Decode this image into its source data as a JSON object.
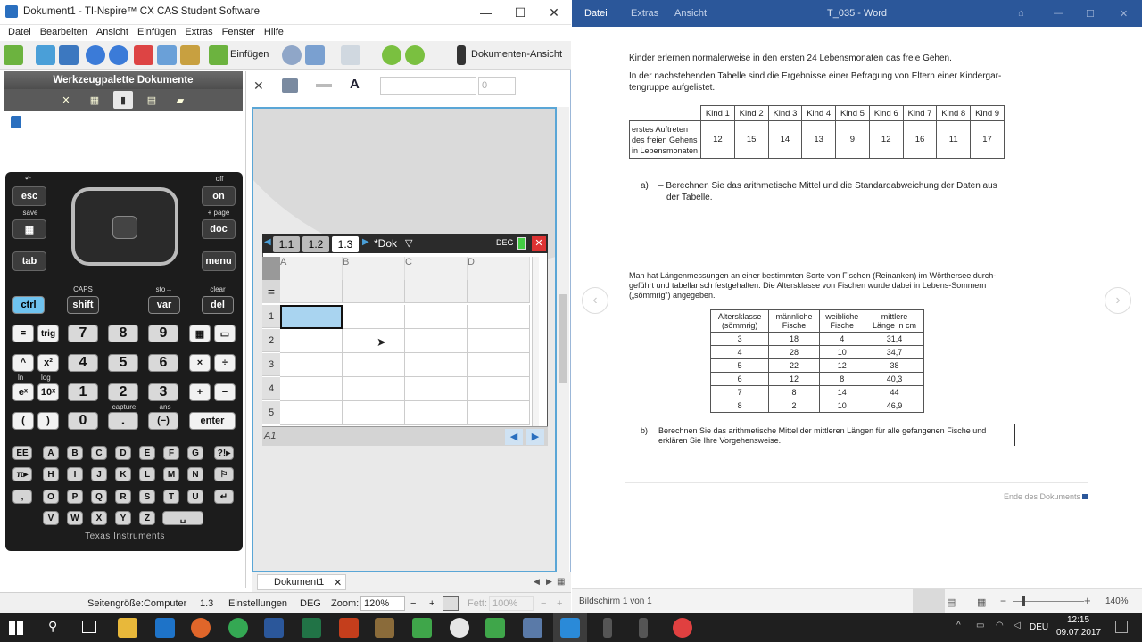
{
  "ti": {
    "title": "Dokument1 - TI-Nspire™ CX CAS Student Software",
    "window_controls": [
      "—",
      "☐",
      "✕"
    ],
    "menu": [
      "Datei",
      "Bearbeiten",
      "Ansicht",
      "Einfügen",
      "Extras",
      "Fenster",
      "Hilfe"
    ],
    "toolbar": {
      "insert_label": "Einfügen",
      "view_label": "Dokumenten-Ansicht",
      "font_size_value": "0"
    },
    "palette_title": "Werkzeugpalette Dokumente",
    "keys": {
      "esc": "esc",
      "on": "on",
      "save": "save",
      "off": "off",
      "page": "+ page",
      "doc": "doc",
      "tab": "tab",
      "menu": "menu",
      "caps": "CAPS",
      "sto": "sto→",
      "clear": "clear",
      "ctrl": "ctrl",
      "shift": "shift",
      "var": "var",
      "del": "del",
      "eq": "=",
      "trig": "trig",
      "n7": "7",
      "n8": "8",
      "n9": "9",
      "caret": "^",
      "x2": "x²",
      "n4": "4",
      "n5": "5",
      "n6": "6",
      "mul": "×",
      "div": "÷",
      "ex": "eˣ",
      "tenx": "10ˣ",
      "n1": "1",
      "n2": "2",
      "n3": "3",
      "plus": "+",
      "minus": "−",
      "lparen": "(",
      "rparen": ")",
      "n0": "0",
      "dot": ".",
      "neg": "(−)",
      "enter": "enter",
      "ln": "ln",
      "log": "log",
      "capture": "capture",
      "ans": "ans",
      "ee": "EE",
      "pi": "π▸",
      "comma": ",",
      "qm": "?!▸",
      "flag": "⚐",
      "letters1": [
        "A",
        "B",
        "C",
        "D",
        "E",
        "F",
        "G"
      ],
      "letters2": [
        "H",
        "I",
        "J",
        "K",
        "L",
        "M",
        "N"
      ],
      "letters3": [
        "O",
        "P",
        "Q",
        "R",
        "S",
        "T",
        "U"
      ],
      "letters4": [
        "V",
        "W",
        "X",
        "Y",
        "Z"
      ]
    },
    "brand": "Texas Instruments",
    "calc": {
      "tabs": [
        "1.1",
        "1.2",
        "1.3"
      ],
      "doc_label": "*Dok",
      "mode": "DEG",
      "columns": [
        "A",
        "B",
        "C",
        "D"
      ],
      "rows": [
        "1",
        "2",
        "3",
        "4",
        "5"
      ],
      "entry_label": "A1"
    },
    "doc_tab": "Dokument1",
    "status": {
      "page_size": "Seitengröße:Computer",
      "page": "1.3",
      "settings": "Einstellungen",
      "mode": "DEG",
      "zoom_label": "Zoom:",
      "zoom": "120%",
      "fett_label": "Fett:",
      "fett": "100%"
    }
  },
  "word": {
    "tabs": [
      "Datei",
      "Extras",
      "Ansicht"
    ],
    "title": "T_035 - Word",
    "intro1": "Kinder erlernen normalerweise in den ersten 24 Lebensmonaten das freie Gehen.",
    "intro2": "In der nachstehenden Tabelle sind die Ergebnisse einer Befragung von Eltern einer Kindergar-",
    "intro3": "tengruppe aufgelistet.",
    "table1": {
      "headers": [
        "",
        "Kind 1",
        "Kind 2",
        "Kind 3",
        "Kind 4",
        "Kind 5",
        "Kind 6",
        "Kind 7",
        "Kind 8",
        "Kind 9"
      ],
      "row_label": [
        "erstes Auftreten",
        "des freien Gehens",
        "in Lebensmonaten"
      ],
      "values": [
        "12",
        "15",
        "14",
        "13",
        "9",
        "12",
        "16",
        "11",
        "17"
      ]
    },
    "task_a_label": "a)",
    "task_a1": "– Berechnen Sie das arithmetische Mittel und die Standardabweichung der Daten aus",
    "task_a2": "der Tabelle.",
    "para2_1": "Man hat Längenmessungen an einer bestimmten Sorte von Fischen (Reinanken) im Wörthersee durch-",
    "para2_2": "geführt und tabellarisch festgehalten. Die Altersklasse von Fischen wurde dabei in Lebens-Sommern",
    "para2_3": "(„sömmrig“) angegeben.",
    "table2": {
      "headers": [
        [
          "Altersklasse",
          "(sömmrig)"
        ],
        [
          "männliche",
          "Fische"
        ],
        [
          "weibliche",
          "Fische"
        ],
        [
          "mittlere",
          "Länge in cm"
        ]
      ],
      "rows": [
        [
          "3",
          "18",
          "4",
          "31,4"
        ],
        [
          "4",
          "28",
          "10",
          "34,7"
        ],
        [
          "5",
          "22",
          "12",
          "38"
        ],
        [
          "6",
          "12",
          "8",
          "40,3"
        ],
        [
          "7",
          "8",
          "14",
          "44"
        ],
        [
          "8",
          "2",
          "10",
          "46,9"
        ]
      ]
    },
    "task_b_label": "b)",
    "task_b1": "Berechnen Sie das arithmetische Mittel der mittleren Längen für alle gefangenen Fische und",
    "task_b2": "erklären Sie Ihre Vorgehensweise.",
    "end_label": "Ende des Dokuments",
    "status_page": "Bildschirm 1 von 1",
    "zoom": "140%"
  },
  "taskbar": {
    "lang": "DEU",
    "time": "12:15",
    "date": "09.07.2017"
  },
  "colors": {
    "word_blue": "#2b579a",
    "ti_frame": "#5aa6d6",
    "cell_sel": "#a9d4f0"
  }
}
